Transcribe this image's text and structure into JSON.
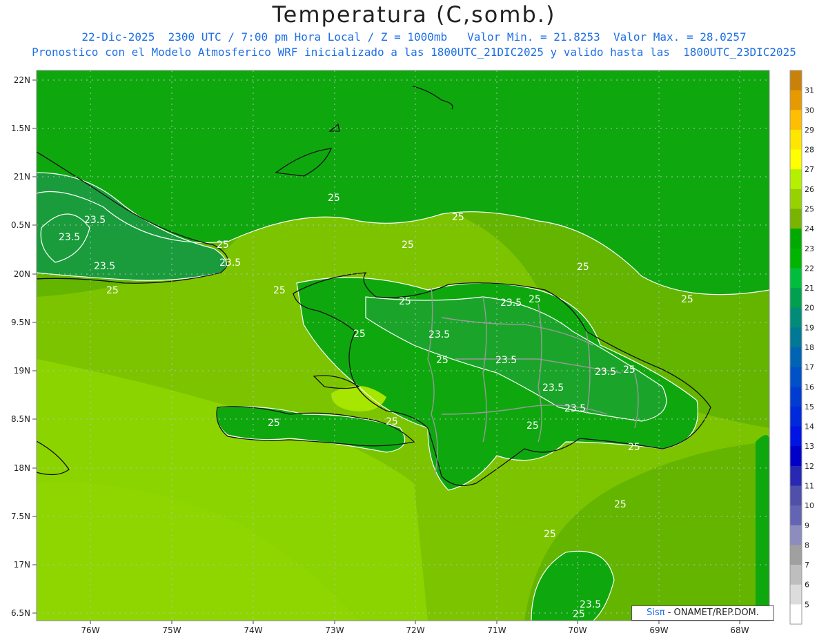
{
  "title": "Temperatura (C,somb.)",
  "subtitle_line1": "22-Dic-2025  2300 UTC / 7:00 pm Hora Local / Z = 1000mb   Valor Min. = 21.8253  Valor Max. = 28.0257",
  "subtitle_line2": "Pronostico con el Modelo Atmosferico WRF inicializado a las 1800UTC_21DIC2025 y valido hasta las  1800UTC_23DIC2025",
  "credit": {
    "brand": "Sisπ",
    "text": " - ONAMET/REP.DOM."
  },
  "axes": {
    "lon_labels": [
      "76W",
      "75W",
      "74W",
      "73W",
      "72W",
      "71W",
      "70W",
      "69W",
      "68W"
    ],
    "lat_labels": [
      "22N",
      "1.5N",
      "21N",
      "0.5N",
      "20N",
      "9.5N",
      "19N",
      "8.5N",
      "18N",
      "7.5N",
      "17N",
      "6.5N"
    ]
  },
  "legend": {
    "labels": [
      "31",
      "30",
      "29",
      "28",
      "27",
      "26",
      "25",
      "24",
      "23",
      "22",
      "21",
      "20",
      "19",
      "18",
      "17",
      "16",
      "15",
      "14",
      "13",
      "12",
      "11",
      "10",
      "9",
      "8",
      "7",
      "6",
      "5"
    ],
    "colors": [
      "#c8820a",
      "#e69a00",
      "#ffbe00",
      "#ffe600",
      "#ffff00",
      "#b4f000",
      "#96d200",
      "#78b400",
      "#00aa00",
      "#00b400",
      "#00be3c",
      "#00a050",
      "#008c78",
      "#007896",
      "#0064b4",
      "#0050c8",
      "#003cd2",
      "#0028dc",
      "#0014e6",
      "#0000c8",
      "#2828b4",
      "#5050aa",
      "#6464b4",
      "#8c8cbe",
      "#a0a0a0",
      "#bebebe",
      "#dcdcdc",
      "#ffffff"
    ]
  },
  "contour_labels": [
    "25",
    "25",
    "25",
    "25",
    "25",
    "25",
    "25",
    "25",
    "25",
    "25",
    "25",
    "25",
    "25",
    "25",
    "25",
    "25",
    "25",
    "25",
    "23.5",
    "23.5",
    "23.5",
    "23.5",
    "23.5",
    "23.5",
    "23.5",
    "23.5",
    "23.5",
    "23.5"
  ],
  "map_colors": {
    "base": "#7cc400",
    "mid": "#59b300",
    "green": "#0fa60f",
    "dark": "#18a040",
    "bright": "#a6e600",
    "light": "#8cd400"
  }
}
